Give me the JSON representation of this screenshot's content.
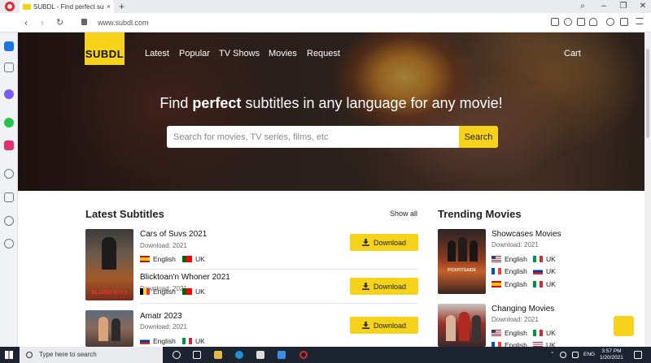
{
  "browser": {
    "tab_title": "SUBDL - Find perfect subtit",
    "tab_close": "×",
    "new_tab": "+",
    "url": "www.subdl.com"
  },
  "site": {
    "logo": "SUBDL",
    "nav": [
      "Latest",
      "Popular",
      "TV Shows",
      "Movies",
      "Request"
    ],
    "cart": "Cart",
    "headline_pre": "Find ",
    "headline_bold": "perfect",
    "headline_post": " subtitles in any language for any movie!",
    "search_placeholder": "Search for movies, TV series, films, etc",
    "search_button": "Search"
  },
  "latest": {
    "heading": "Latest Subtitles",
    "show_all": "Show all",
    "items": [
      {
        "title": "Cars of Suvs 2021",
        "sub": "Download: 2021",
        "lang1": "English",
        "lang2": "UK",
        "download": "Download",
        "poster_text": "BLADED SUY 2"
      },
      {
        "title": "Blicktoan'n Whoner 2021",
        "sub": "Download: 2021",
        "lang1": "English",
        "lang2": "UK",
        "download": "Download"
      },
      {
        "title": "Amatr 2023",
        "sub": "Download: 2021",
        "lang1": "English",
        "lang2": "UK",
        "download": "Download"
      }
    ]
  },
  "trending": {
    "heading": "Trending Movies",
    "items": [
      {
        "title": "Showcases Movies",
        "sub": "Download: 2021",
        "langs": [
          [
            "English",
            "UK"
          ],
          [
            "English",
            "UK"
          ],
          [
            "English",
            "UK"
          ]
        ],
        "poster_text": "PICKPITSAIDE"
      },
      {
        "title": "Changing Movies",
        "sub": "Download: 2021",
        "langs": [
          [
            "English",
            "UK"
          ],
          [
            "English",
            "UK"
          ]
        ]
      }
    ]
  },
  "taskbar": {
    "search_placeholder": "Type here to search",
    "lang": "ENG",
    "time": "3:57 PM",
    "date": "1/20/2021"
  },
  "colors": {
    "accent": "#f6d31a",
    "taskbar": "#1c2431"
  }
}
